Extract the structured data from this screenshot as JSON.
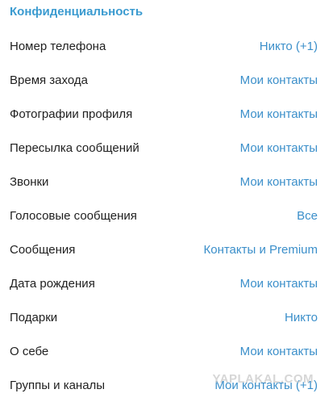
{
  "section": {
    "title": "Конфиденциальность"
  },
  "rows": [
    {
      "label": "Номер телефона",
      "value": "Никто (+1)"
    },
    {
      "label": "Время захода",
      "value": "Мои контакты"
    },
    {
      "label": "Фотографии профиля",
      "value": "Мои контакты"
    },
    {
      "label": "Пересылка сообщений",
      "value": "Мои контакты"
    },
    {
      "label": "Звонки",
      "value": "Мои контакты"
    },
    {
      "label": "Голосовые сообщения",
      "value": "Все"
    },
    {
      "label": "Сообщения",
      "value": "Контакты и Premium"
    },
    {
      "label": "Дата рождения",
      "value": "Мои контакты"
    },
    {
      "label": "Подарки",
      "value": "Никто"
    },
    {
      "label": "О себе",
      "value": "Мои контакты"
    },
    {
      "label": "Группы и каналы",
      "value": "Мои контакты (+1)"
    }
  ],
  "watermark": "YAPLAKAL.COM",
  "colors": {
    "accent": "#3b9bd0",
    "value_link": "#3b8fca",
    "label_text": "#1f1f1f",
    "background": "#ffffff"
  }
}
